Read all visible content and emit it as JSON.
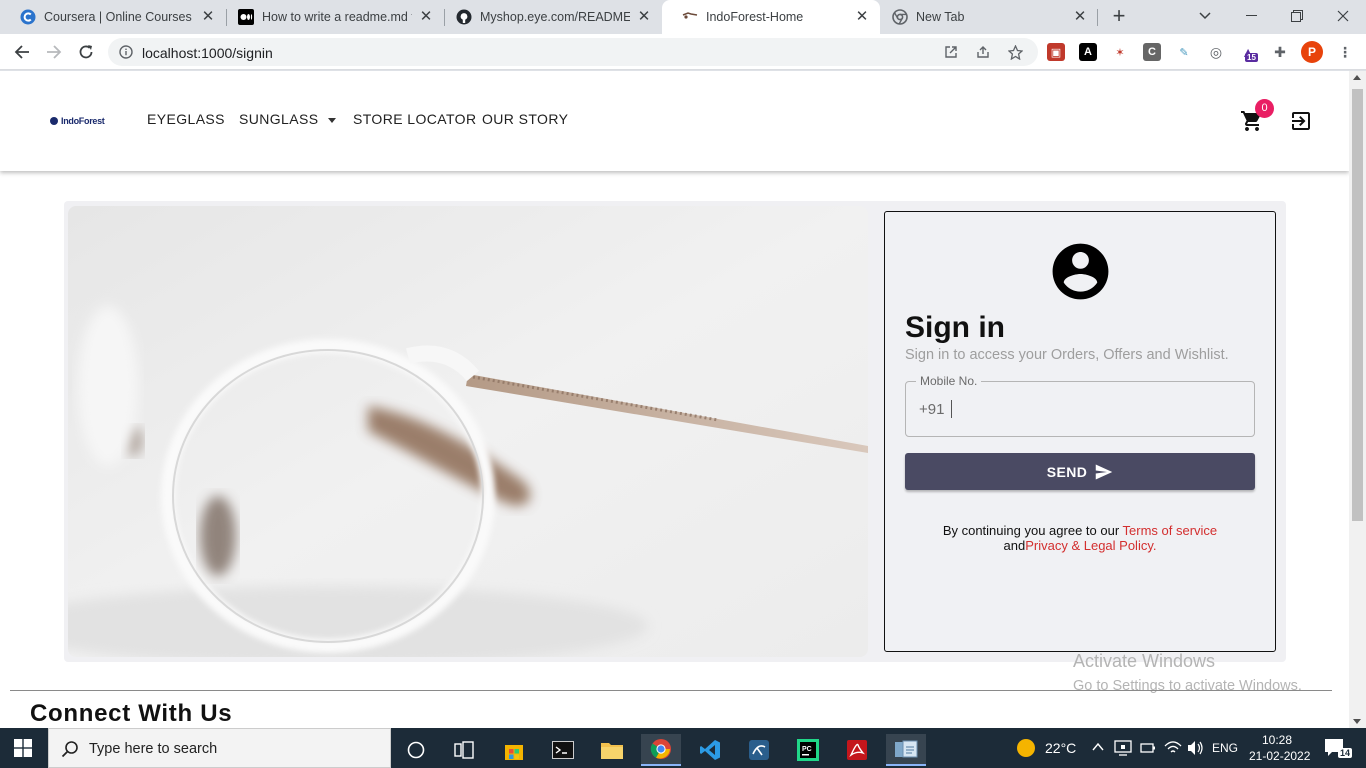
{
  "browser": {
    "tabs": [
      {
        "title": "Coursera | Online Courses & ",
        "favicon": "coursera-icon",
        "active": false
      },
      {
        "title": "How to write a readme.md fil",
        "favicon": "medium-icon",
        "active": false
      },
      {
        "title": "Myshop.eye.com/README.m",
        "favicon": "github-icon",
        "active": false
      },
      {
        "title": "IndoForest-Home",
        "favicon": "glasses-favicon-icon",
        "active": true
      },
      {
        "title": "New Tab",
        "favicon": "chrome-icon",
        "active": false
      }
    ],
    "url": "localhost:1000/signin",
    "profile_initial": "P",
    "extension_badge": "15"
  },
  "site": {
    "logo_text": "IndoForest",
    "nav": [
      {
        "label": "EYEGLASS"
      },
      {
        "label": "SUNGLASS"
      },
      {
        "label": "STORE LOCATOR"
      },
      {
        "label": "OUR STORY"
      }
    ],
    "cart_count": "0"
  },
  "signin": {
    "title": "Sign in",
    "subtitle": "Sign in to access your Orders, Offers and Wishlist.",
    "mobile_label": "Mobile No.",
    "mobile_prefix": "+91",
    "mobile_value": "",
    "send_label": "SEND",
    "terms_prefix": "By continuing you agree to our ",
    "terms_link": "Terms of service",
    "terms_and": "and",
    "privacy_link": "Privacy & Legal Policy."
  },
  "footer": {
    "connect_title": "Connect With Us"
  },
  "watermark": {
    "line1": "Activate Windows",
    "line2": "Go to Settings to activate Windows."
  },
  "taskbar": {
    "search_placeholder": "Type here to search",
    "weather": "22°C",
    "language": "ENG",
    "time": "10:28",
    "date": "21-02-2022",
    "notification_count": "14"
  },
  "colors": {
    "send_button": "#4a4a63",
    "link_red": "#d32f2f",
    "badge_pink": "#e91e63",
    "taskbar": "#1c2b38"
  }
}
